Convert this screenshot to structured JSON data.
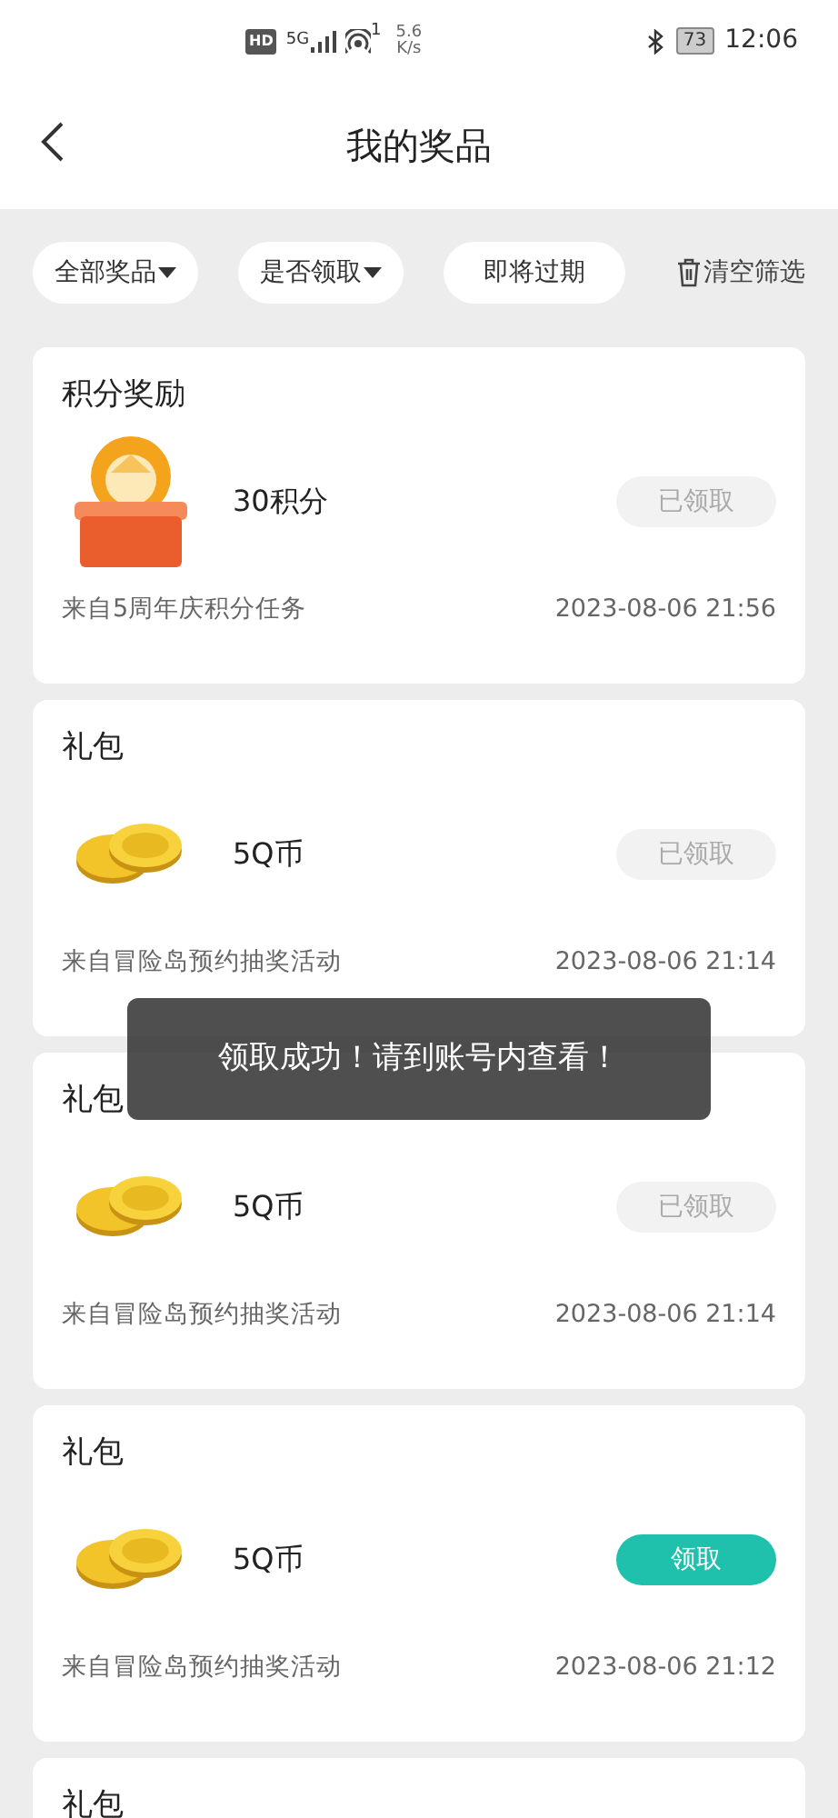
{
  "status_bar": {
    "hd": "HD",
    "network": "5G",
    "wifi_count": "1",
    "speed": "5.6",
    "speed_unit": "K/s",
    "battery": "73",
    "time": "12:06"
  },
  "header": {
    "title": "我的奖品"
  },
  "filters": [
    {
      "label": "全部奖品",
      "dropdown": true
    },
    {
      "label": "是否领取",
      "dropdown": true
    },
    {
      "label": "即将过期",
      "dropdown": false
    }
  ],
  "clear_filter": {
    "label": "清空筛选"
  },
  "prizes": [
    {
      "title": "积分奖励",
      "kind": "points",
      "name": "30积分",
      "button": "已领取",
      "claimed": true,
      "source": "来自5周年庆积分任务",
      "time": "2023-08-06 21:56"
    },
    {
      "title": "礼包",
      "kind": "coins",
      "name": "5Q币",
      "button": "已领取",
      "claimed": true,
      "source": "来自冒险岛预约抽奖活动",
      "time": "2023-08-06 21:14"
    },
    {
      "title": "礼包",
      "kind": "coins",
      "name": "5Q币",
      "button": "已领取",
      "claimed": true,
      "source": "来自冒险岛预约抽奖活动",
      "time": "2023-08-06 21:14"
    },
    {
      "title": "礼包",
      "kind": "coins",
      "name": "5Q币",
      "button": "领取",
      "claimed": false,
      "source": "来自冒险岛预约抽奖活动",
      "time": "2023-08-06 21:12"
    },
    {
      "title": "礼包",
      "kind": "partial"
    }
  ],
  "toast": {
    "message": "领取成功！请到账号内查看！"
  }
}
